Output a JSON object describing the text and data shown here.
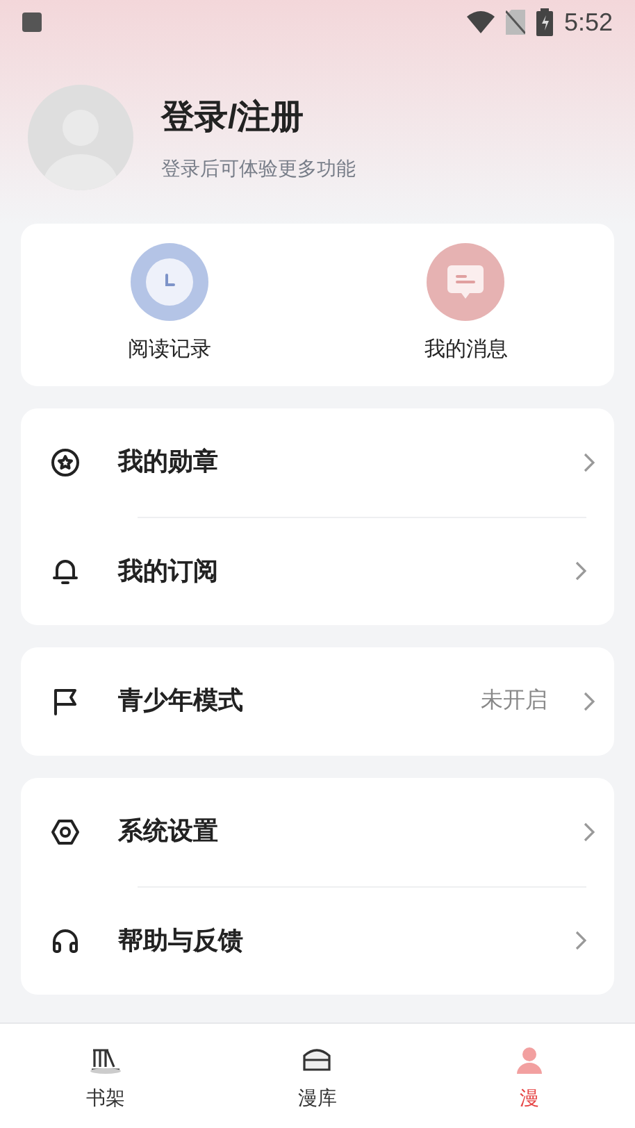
{
  "status_bar": {
    "time": "5:52"
  },
  "profile": {
    "title": "登录/注册",
    "subtitle": "登录后可体验更多功能"
  },
  "shortcuts": [
    {
      "label": "阅读记录",
      "kind": "history"
    },
    {
      "label": "我的消息",
      "kind": "message"
    }
  ],
  "menu_groups": [
    [
      {
        "label": "我的勋章",
        "kind": "medal"
      },
      {
        "label": "我的订阅",
        "kind": "bell"
      }
    ],
    [
      {
        "label": "青少年模式",
        "kind": "flag",
        "value": "未开启"
      }
    ],
    [
      {
        "label": "系统设置",
        "kind": "settings"
      },
      {
        "label": "帮助与反馈",
        "kind": "headset"
      }
    ]
  ],
  "tabs": [
    {
      "label": "书架",
      "kind": "shelf",
      "selected": false
    },
    {
      "label": "漫库",
      "kind": "store",
      "selected": false
    },
    {
      "label": "漫",
      "kind": "mine",
      "selected": true
    }
  ]
}
